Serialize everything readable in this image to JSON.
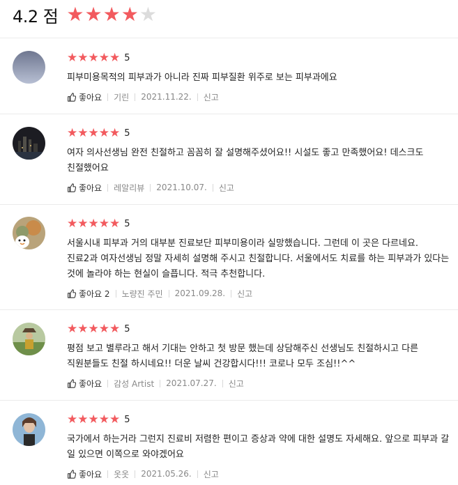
{
  "summary": {
    "score": "4.2 점",
    "rating": 4.2,
    "star_color": "#f25a5e",
    "empty_star_color": "#dcdcdc"
  },
  "reviews": [
    {
      "rating": "5",
      "text": "피부미용목적의 피부과가 아니라 진짜 피부질환 위주로 보는 피부과에요",
      "like": "좋아요",
      "author": "기린",
      "date": "2021.11.22.",
      "report": "신고"
    },
    {
      "rating": "5",
      "text": "여자 의사선생님 완전 친절하고 꼼꼼히 잘 설명해주셨어요!! 시설도 좋고 만족했어요! 데스크도 친절했어요",
      "like": "좋아요",
      "author": "레알리뷰",
      "date": "2021.10.07.",
      "report": "신고"
    },
    {
      "rating": "5",
      "text": "서울시내 피부과 거의 대부분 진료보단 피부미용이라 실망했습니다. 그런데 이 곳은 다르네요. 진료2과 여자선생님 정말 자세히 설명해 주시고 친절합니다. 서울에서도 치료를 하는 피부과가 있다는 것에 놀라야 하는 현실이 슬픕니다. 적극 추천합니다.",
      "like": "좋아요 2",
      "author": "노량진 주민",
      "date": "2021.09.28.",
      "report": "신고"
    },
    {
      "rating": "5",
      "text": "평점 보고 별루라고 해서 기대는 안하고 첫 방문 했는데  상담해주신 선생님도 친절하시고  다른 직원분들도 친절 하시네요!!  더운 날씨 건강합시다!!!  코로나 모두 조심!!^^",
      "like": "좋아요",
      "author": "감성 Artist",
      "date": "2021.07.27.",
      "report": "신고"
    },
    {
      "rating": "5",
      "text": "국가에서 하는거라 그런지 진료비 저렴한 편이고 증상과 약에 대한 설명도 자세해요. 앞으로 피부과 갈 일 있으면 이쪽으로 와야겠어요",
      "like": "좋아요",
      "author": "옷옷",
      "date": "2021.05.26.",
      "report": "신고"
    }
  ]
}
